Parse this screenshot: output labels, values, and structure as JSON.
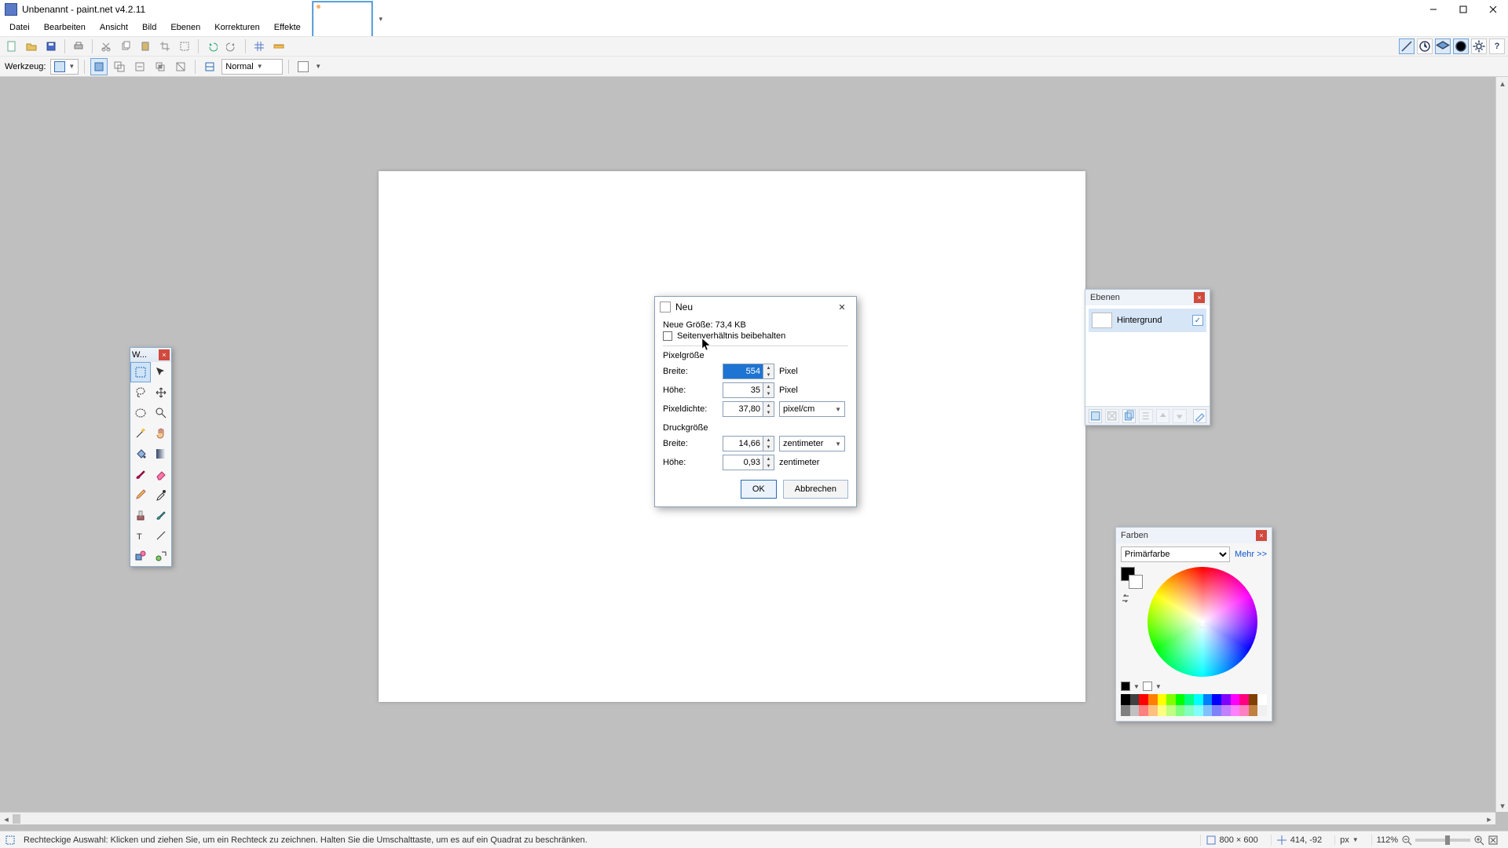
{
  "window": {
    "title": "Unbenannt - paint.net v4.2.11"
  },
  "menu": {
    "items": [
      "Datei",
      "Bearbeiten",
      "Ansicht",
      "Bild",
      "Ebenen",
      "Korrekturen",
      "Effekte"
    ]
  },
  "toolbar2": {
    "tool_label": "Werkzeug:",
    "blend_label": "Normal"
  },
  "tools_window": {
    "title": "W..."
  },
  "layers": {
    "title": "Ebenen",
    "row_name": "Hintergrund"
  },
  "colors": {
    "title": "Farben",
    "mode": "Primärfarbe",
    "more": "Mehr >>"
  },
  "dialog": {
    "title": "Neu",
    "size_label": "Neue Größe: 73,4 KB",
    "keep_ratio": "Seitenverhältnis beibehalten",
    "group_pixel": "Pixelgröße",
    "group_print": "Druckgröße",
    "width_label": "Breite:",
    "height_label": "Höhe:",
    "dpi_label": "Pixeldichte:",
    "pixel_unit": "Pixel",
    "dpi_unit": "pixel/cm",
    "cm_unit": "zentimeter",
    "px_width": "554",
    "px_height": "35",
    "dpi": "37,80",
    "print_w": "14,66",
    "print_h": "0,93",
    "ok": "OK",
    "cancel": "Abbrechen"
  },
  "status": {
    "hint": "Rechteckige Auswahl: Klicken und ziehen Sie, um ein Rechteck zu zeichnen. Halten Sie die Umschalttaste, um es auf ein Quadrat zu beschränken.",
    "docsize": "800 × 600",
    "coords": "414, -92",
    "px": "px",
    "zoom": "112%"
  },
  "palette": [
    "#000000",
    "#404040",
    "#ff0000",
    "#ff8000",
    "#ffff00",
    "#80ff00",
    "#00ff00",
    "#00ff80",
    "#00ffff",
    "#0080ff",
    "#0000ff",
    "#8000ff",
    "#ff00ff",
    "#ff0080",
    "#804000",
    "#ffffff",
    "#808080",
    "#c0c0c0",
    "#ff8080",
    "#ffc080",
    "#ffff80",
    "#c0ff80",
    "#80ff80",
    "#80ffc0",
    "#80ffff",
    "#80c0ff",
    "#8080ff",
    "#c080ff",
    "#ff80ff",
    "#ff80c0",
    "#c08040",
    "#f0f0f0"
  ]
}
